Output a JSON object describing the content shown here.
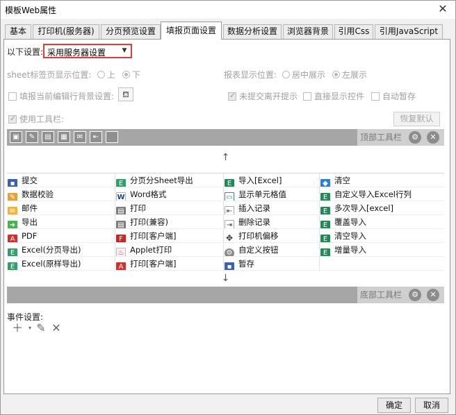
{
  "window": {
    "title": "模板Web属性",
    "close": "✕"
  },
  "tabs": [
    "基本",
    "打印机(服务器)",
    "分页预览设置",
    "填报页面设置",
    "数据分析设置",
    "浏览器背景",
    "引用Css",
    "引用JavaScript"
  ],
  "active_tab": "填报页面设置",
  "settings": {
    "setting_label": "以下设置:",
    "setting_value": "采用服务器设置",
    "sheet_pos_label": "sheet标签页显示位置:",
    "sheet_pos_options": [
      "上",
      "下"
    ],
    "sheet_pos_selected": "下",
    "report_pos_label": "报表显示位置:",
    "report_pos_options": [
      "居中展示",
      "左展示"
    ],
    "report_pos_selected": "左展示",
    "fill_bg_label": "填报当前编辑行背景设置:",
    "unsubmitted_label": "未提交离开提示",
    "direct_control_label": "直接显示控件",
    "autosave_label": "自动暂存",
    "use_toolbar_label": "使用工具栏:",
    "restore_default": "恢复默认",
    "top_toolbar_label": "顶部工具栏",
    "bottom_toolbar_label": "底部工具栏",
    "arrow_up": "↑",
    "arrow_down": "↓"
  },
  "buttons_grid": [
    [
      {
        "label": "提交",
        "icon": "save-icon"
      },
      {
        "label": "分页分Sheet导出",
        "icon": "excel-icon"
      },
      {
        "label": "导入[Excel]",
        "icon": "excel-import-icon"
      },
      {
        "label": "清空",
        "icon": "eraser-icon"
      }
    ],
    [
      {
        "label": "数据校验",
        "icon": "pencil-icon"
      },
      {
        "label": "Word格式",
        "icon": "word-icon"
      },
      {
        "label": "显示单元格值",
        "icon": "cell-icon"
      },
      {
        "label": "自定义导入Excel行列",
        "icon": "excel-import-icon"
      }
    ],
    [
      {
        "label": "邮件",
        "icon": "mail-icon"
      },
      {
        "label": "打印",
        "icon": "print-icon"
      },
      {
        "label": "插入记录",
        "icon": "insert-row-icon"
      },
      {
        "label": "多次导入[excel]",
        "icon": "excel-import-icon"
      }
    ],
    [
      {
        "label": "导出",
        "icon": "export-icon"
      },
      {
        "label": "打印(兼容)",
        "icon": "print-icon"
      },
      {
        "label": "删除记录",
        "icon": "delete-row-icon"
      },
      {
        "label": "覆盖导入",
        "icon": "excel-import-icon"
      }
    ],
    [
      {
        "label": "PDF",
        "icon": "pdf-icon"
      },
      {
        "label": "打印[客户端]",
        "icon": "fr-print-icon"
      },
      {
        "label": "打印机偏移",
        "icon": "move-icon"
      },
      {
        "label": "清空导入",
        "icon": "excel-import-icon"
      }
    ],
    [
      {
        "label": "Excel(分页导出)",
        "icon": "excel-icon"
      },
      {
        "label": "Applet打印",
        "icon": "applet-icon"
      },
      {
        "label": "自定义按钮",
        "icon": "gear-icon"
      },
      {
        "label": "增量导入",
        "icon": "excel-import-icon"
      }
    ],
    [
      {
        "label": "Excel(原样导出)",
        "icon": "excel-icon"
      },
      {
        "label": "打印[客户端]",
        "icon": "pdf-icon"
      },
      {
        "label": "暂存",
        "icon": "save-icon"
      },
      {
        "label": "",
        "icon": ""
      }
    ]
  ],
  "events": {
    "label": "事件设置:"
  },
  "footer": {
    "ok": "确定",
    "cancel": "取消"
  }
}
